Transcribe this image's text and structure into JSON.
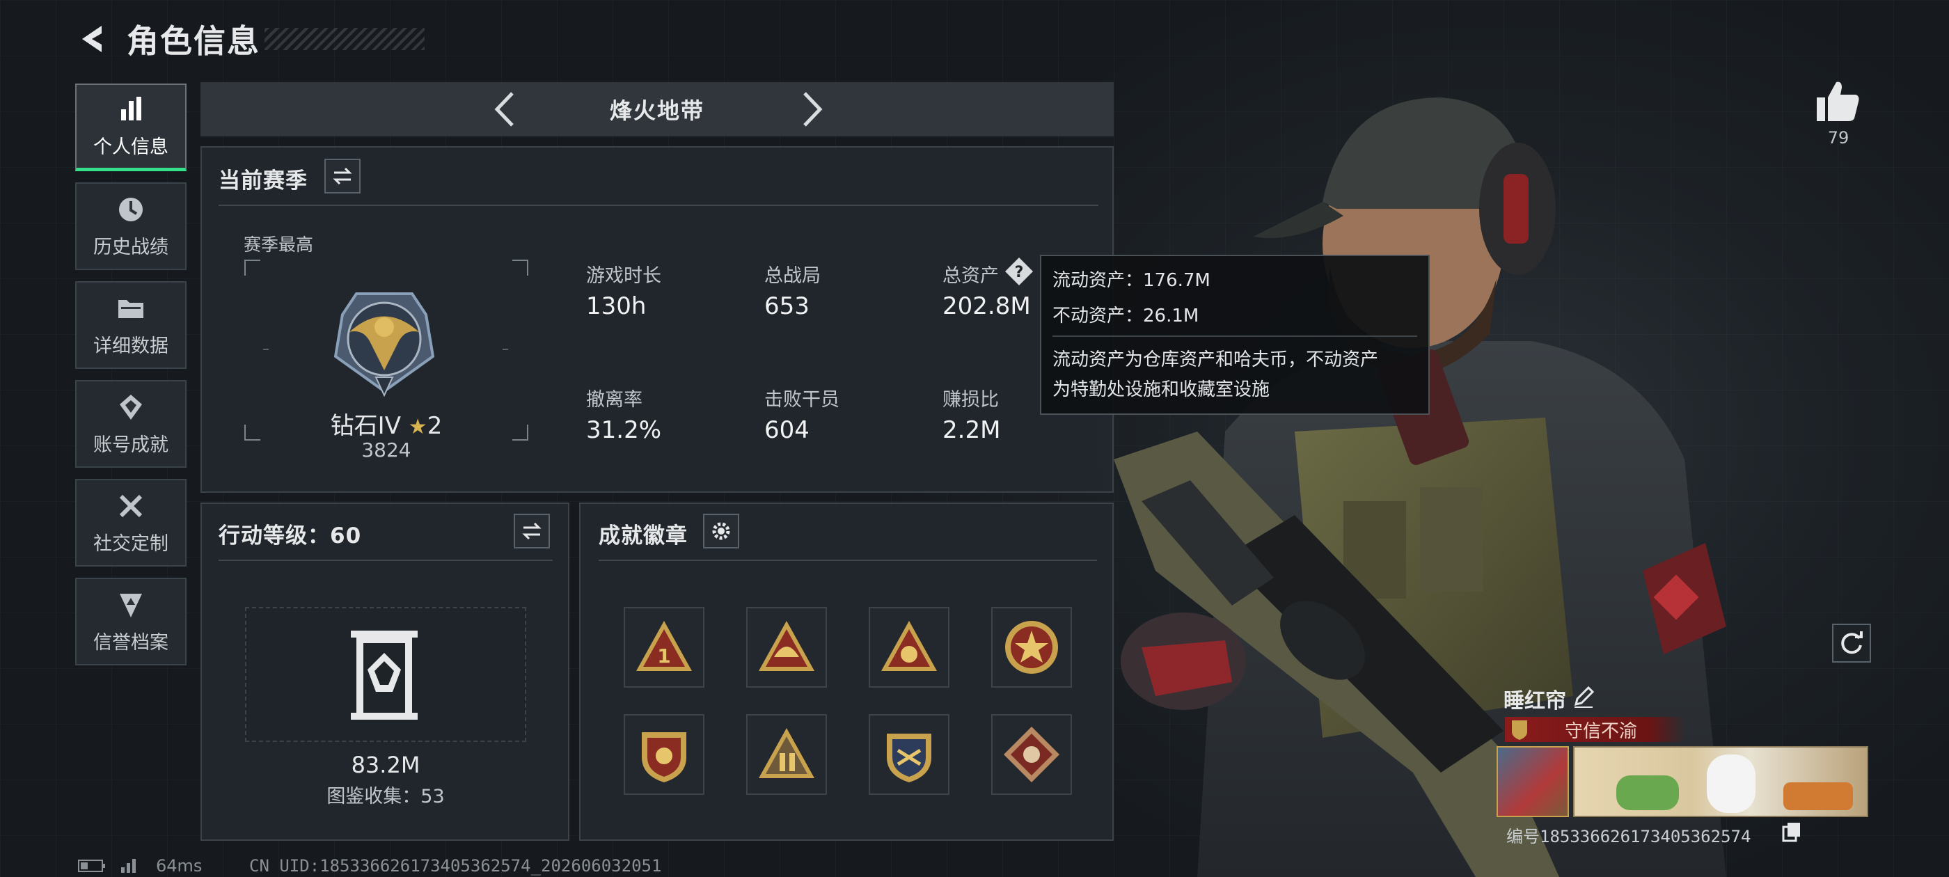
{
  "header": {
    "title": "角色信息"
  },
  "sidebar": {
    "items": [
      {
        "label": "个人信息",
        "icon": "bar-chart-icon",
        "active": true
      },
      {
        "label": "历史战绩",
        "icon": "clock-icon"
      },
      {
        "label": "详细数据",
        "icon": "folder-icon"
      },
      {
        "label": "账号成就",
        "icon": "achievement-icon"
      },
      {
        "label": "社交定制",
        "icon": "tools-icon"
      },
      {
        "label": "信誉档案",
        "icon": "credit-shield-icon"
      }
    ]
  },
  "mode_selector": {
    "title": "烽火地带"
  },
  "season": {
    "title": "当前赛季",
    "best_label": "赛季最高",
    "rank_name": "钻石IV",
    "rank_stars": "2",
    "rank_score": "3824",
    "stats": [
      {
        "label": "游戏时长",
        "value": "130h"
      },
      {
        "label": "总战局",
        "value": "653"
      },
      {
        "label": "总资产",
        "value": "202.8M"
      },
      {
        "label": "撤离率",
        "value": "31.2%"
      },
      {
        "label": "击败干员",
        "value": "604"
      },
      {
        "label": "赚损比",
        "value": "2.2M"
      }
    ]
  },
  "tooltip": {
    "line1": "流动资产：176.7M",
    "line2": "不动资产：26.1M",
    "desc1": "流动资产为仓库资产和哈夫币，不动资产",
    "desc2": "为特勤处设施和收藏室设施"
  },
  "action_level": {
    "title": "行动等级：60",
    "value": "83.2M",
    "collection": "图鉴收集：53"
  },
  "achievements": {
    "title": "成就徽章",
    "badges": [
      "badge-1",
      "badge-2",
      "badge-3",
      "badge-4",
      "badge-5",
      "badge-6",
      "badge-7",
      "badge-8"
    ]
  },
  "profile": {
    "likes": "79",
    "name": "睡红帘",
    "title_badge": "守信不渝",
    "id_text": "编号18533662617340536257​4"
  },
  "status_bar": {
    "ping": "64ms",
    "uid": "CN UID:18533662617340536257​4_202606032051"
  },
  "colors": {
    "accent_green": "#35e08a",
    "title_red": "#8b1c1c",
    "bg": "#1a1f24"
  }
}
